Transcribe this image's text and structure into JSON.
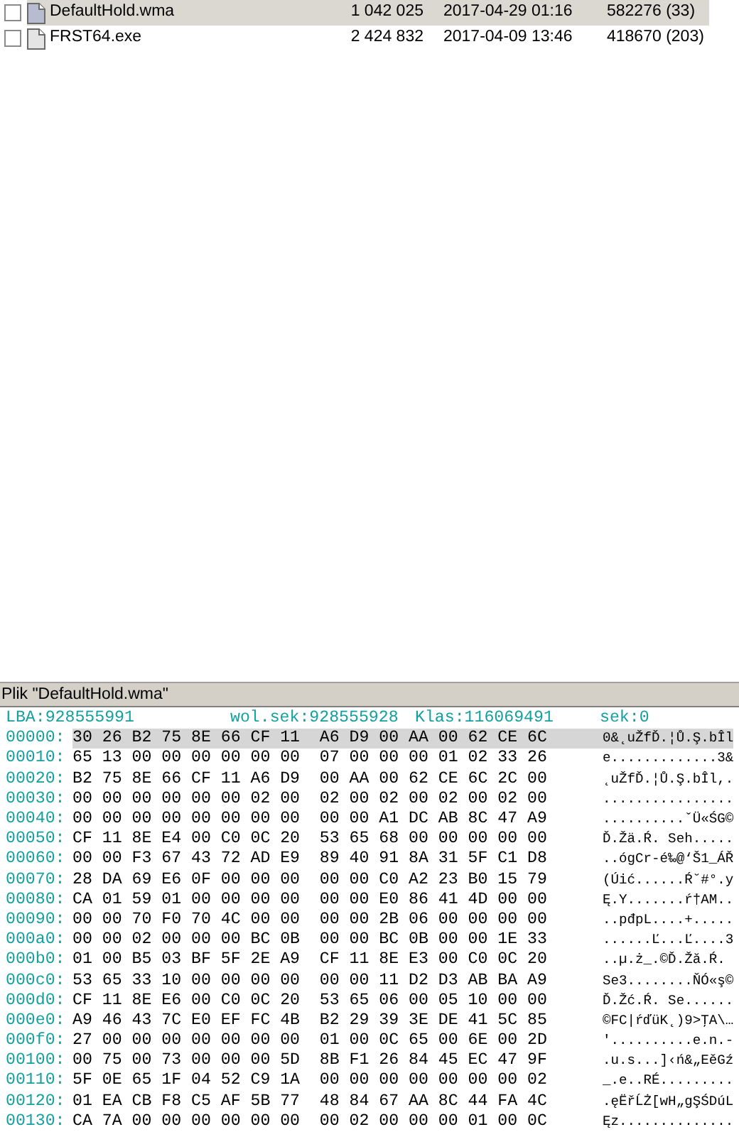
{
  "files": [
    {
      "name": "DefaultHold.wma",
      "size": "1 042 025",
      "date": "2017-04-29 01:16",
      "clusters": "582276 (33)",
      "checked": false,
      "selected": true
    },
    {
      "name": "FRST64.exe",
      "size": "2 424 832",
      "date": "2017-04-09 13:46",
      "clusters": "418670 (203)",
      "checked": false,
      "selected": false
    }
  ],
  "hex_panel": {
    "title": "Plik \"DefaultHold.wma\"",
    "lba": "LBA:928555991",
    "free_sector": "wol.sek:928555928",
    "cluster": "Klas:116069491",
    "sector": "sek:0",
    "rows": [
      {
        "offset": "00000:",
        "hex": "30 26 B2 75 8E 66 CF 11  A6 D9 00 AA 00 62 CE 6C",
        "ascii": "0&˛uŽfĎ.¦Ů.Ş.bÎl",
        "selected": true
      },
      {
        "offset": "00010:",
        "hex": "65 13 00 00 00 00 00 00  07 00 00 00 01 02 33 26",
        "ascii": "e.............3&",
        "selected": false
      },
      {
        "offset": "00020:",
        "hex": "B2 75 8E 66 CF 11 A6 D9  00 AA 00 62 CE 6C 2C 00",
        "ascii": "˛uŽfĎ.¦Ů.Ş.bÎl,.",
        "selected": false
      },
      {
        "offset": "00030:",
        "hex": "00 00 00 00 00 00 02 00  02 00 02 00 02 00 02 00",
        "ascii": "................",
        "selected": false
      },
      {
        "offset": "00040:",
        "hex": "00 00 00 00 00 00 00 00  00 00 A1 DC AB 8C 47 A9",
        "ascii": "..........ˇÜ«ŚG©",
        "selected": false
      },
      {
        "offset": "00050:",
        "hex": "CF 11 8E E4 00 C0 0C 20  53 65 68 00 00 00 00 00",
        "ascii": "Ď.Žä.Ŕ. Seh.....",
        "selected": false
      },
      {
        "offset": "00060:",
        "hex": "00 00 F3 67 43 72 AD E9  89 40 91 8A 31 5F C1 D8",
        "ascii": "..ógCr-é‰@‘Š1_ÁŘ",
        "selected": false
      },
      {
        "offset": "00070:",
        "hex": "28 DA 69 E6 0F 00 00 00  00 00 C0 A2 23 B0 15 79",
        "ascii": "(Úić......Ŕ˘#°.y",
        "selected": false
      },
      {
        "offset": "00080:",
        "hex": "CA 01 59 01 00 00 00 00  00 00 E0 86 41 4D 00 00",
        "ascii": "Ę.Y.......ŕ†AM..",
        "selected": false
      },
      {
        "offset": "00090:",
        "hex": "00 00 70 F0 70 4C 00 00  00 00 2B 06 00 00 00 00",
        "ascii": "..pđpL....+.....",
        "selected": false
      },
      {
        "offset": "000a0:",
        "hex": "00 00 02 00 00 00 BC 0B  00 00 BC 0B 00 00 1E 33",
        "ascii": "......Ľ...Ľ....3",
        "selected": false
      },
      {
        "offset": "000b0:",
        "hex": "01 00 B5 03 BF 5F 2E A9  CF 11 8E E3 00 C0 0C 20",
        "ascii": "..µ.ż_.©Ď.Žă.Ŕ.",
        "selected": false
      },
      {
        "offset": "000c0:",
        "hex": "53 65 33 10 00 00 00 00  00 00 11 D2 D3 AB BA A9",
        "ascii": "Se3........ŇÓ«ş©",
        "selected": false
      },
      {
        "offset": "000d0:",
        "hex": "CF 11 8E E6 00 C0 0C 20  53 65 06 00 05 10 00 00",
        "ascii": "Ď.Žć.Ŕ. Se......",
        "selected": false
      },
      {
        "offset": "000e0:",
        "hex": "A9 46 43 7C E0 EF FC 4B  B2 29 39 3E DE 41 5C 85",
        "ascii": "©FC|ŕďüK˛)9>ŢA\\…",
        "selected": false
      },
      {
        "offset": "000f0:",
        "hex": "27 00 00 00 00 00 00 00  01 00 0C 65 00 6E 00 2D",
        "ascii": "'..........e.n.-",
        "selected": false
      },
      {
        "offset": "00100:",
        "hex": "00 75 00 73 00 00 00 5D  8B F1 26 84 45 EC 47 9F",
        "ascii": ".u.s...]‹ń&„EěGź",
        "selected": false
      },
      {
        "offset": "00110:",
        "hex": "5F 0E 65 1F 04 52 C9 1A  00 00 00 00 00 00 00 02",
        "ascii": "_.e..RÉ.........",
        "selected": false
      },
      {
        "offset": "00120:",
        "hex": "01 EA CB F8 C5 AF 5B 77  48 84 67 AA 8C 44 FA 4C",
        "ascii": ".ęËřĹŻ[wH„gŞŚDúL",
        "selected": false
      },
      {
        "offset": "00130:",
        "hex": "CA 7A 00 00 00 00 00 00  00 02 00 00 00 01 00 0C",
        "ascii": "Ęz..............",
        "selected": false
      }
    ]
  }
}
